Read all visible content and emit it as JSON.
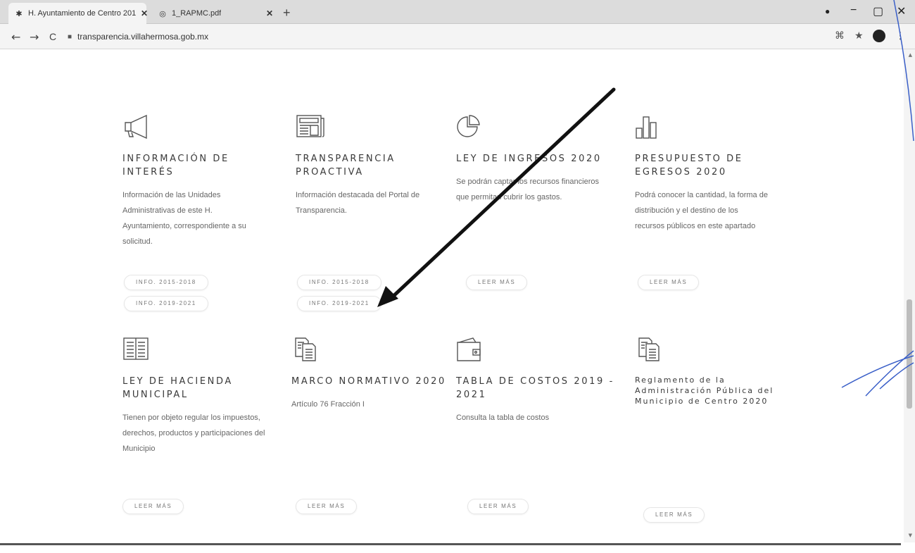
{
  "browser": {
    "tabs": [
      {
        "title": "H. Ayuntamiento de Centro 201",
        "active": true
      },
      {
        "title": "1_RAPMC.pdf",
        "active": false
      }
    ],
    "new_tab": "+",
    "window_controls": {
      "minimize": "−",
      "maximize": "▢",
      "close": "✕"
    },
    "nav": {
      "back": "←",
      "forward": "→",
      "reload": "C"
    },
    "url": "transparencia.villahermosa.gob.mx"
  },
  "cards": [
    {
      "icon": "megaphone-icon",
      "title": "INFORMACIÓN DE INTERÉS",
      "desc": "Información de las Unidades Administrativas de este H. Ayuntamiento, correspondiente a su solicitud.",
      "buttons": [
        "INFO. 2015-2018",
        "INFO. 2019-2021"
      ]
    },
    {
      "icon": "newspaper-icon",
      "title": "TRANSPARENCIA PROACTIVA",
      "desc": "Información destacada del Portal de Transparencia.",
      "buttons": [
        "INFO. 2015-2018",
        "INFO. 2019-2021"
      ]
    },
    {
      "icon": "pie-chart-icon",
      "title": "LEY DE INGRESOS 2020",
      "desc": "Se podrán captar los recursos financieros que permitan cubrir los gastos.",
      "buttons": [
        "LEER MÁS"
      ]
    },
    {
      "icon": "bar-chart-icon",
      "title": "PRESUPUESTO DE EGRESOS 2020",
      "desc": "Podrá conocer la cantidad, la forma de distribución y el destino de los recursos públicos en este apartado",
      "buttons": [
        "LEER MÁS"
      ]
    },
    {
      "icon": "book-icon",
      "title": "LEY DE HACIENDA MUNICIPAL",
      "desc": "Tienen por objeto regular los impuestos, derechos, productos y participaciones del Municipio",
      "buttons": [
        "LEER MÁS"
      ]
    },
    {
      "icon": "documents-icon",
      "title": "MARCO NORMATIVO 2020",
      "desc": "Artículo 76 Fracción I",
      "buttons": [
        "LEER MÁS"
      ]
    },
    {
      "icon": "wallet-icon",
      "title": "TABLA DE COSTOS 2019 - 2021",
      "desc": "Consulta la tabla de costos",
      "buttons": [
        "LEER MÁS"
      ]
    },
    {
      "icon": "documents-icon",
      "title": "Reglamento de la Administración Pública del Municipio de Centro 2020",
      "desc": "",
      "buttons": [
        "LEER MÁS"
      ]
    }
  ]
}
